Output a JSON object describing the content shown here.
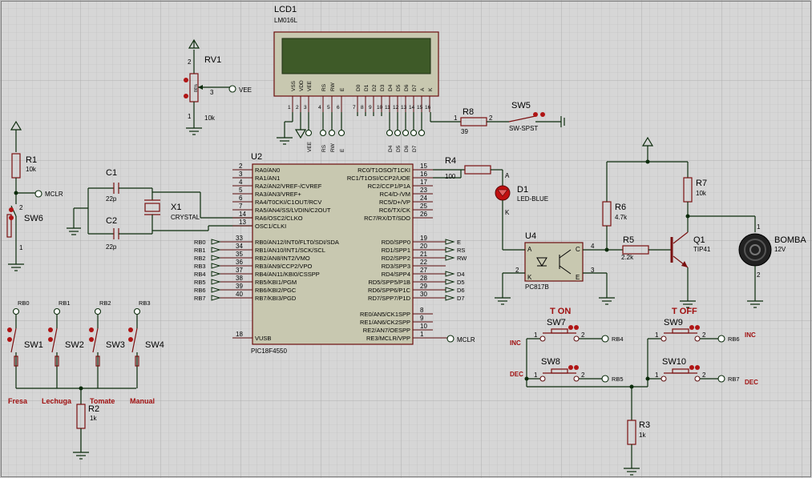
{
  "colors": {
    "grid_bg": "#d6d6d6",
    "grid_line": "#b9b9b9",
    "wire": "#0b2b0b",
    "component": "#7a1010",
    "chip_body": "#c8c8b0",
    "lcd_screen": "#3e5a28",
    "red_label": "#a01010"
  },
  "lcd": {
    "ref": "LCD1",
    "part": "LM016L",
    "pins": [
      "VSS",
      "VDD",
      "VEE",
      "RS",
      "RW",
      "E",
      "D0",
      "D1",
      "D2",
      "D3",
      "D4",
      "D5",
      "D6",
      "D7",
      "A",
      "K"
    ],
    "pin_numbers": [
      "1",
      "2",
      "3",
      "4",
      "5",
      "6",
      "7",
      "8",
      "9",
      "10",
      "11",
      "12",
      "13",
      "14",
      "15",
      "16"
    ],
    "net_left": [
      "VEE",
      "RS",
      "RW",
      "E"
    ],
    "net_data": [
      "D4",
      "D5",
      "D6",
      "D7"
    ]
  },
  "rv1": {
    "ref": "RV1",
    "value": "10k",
    "net": "VEE",
    "pin_top": "2",
    "pin_wiper": "3",
    "pin_bottom": "1",
    "body_text": "86%"
  },
  "r1": {
    "ref": "R1",
    "value": "10k",
    "net": "MCLR"
  },
  "sw6": {
    "ref": "SW6",
    "pin_top": "2",
    "pin_bottom": "1"
  },
  "c1": {
    "ref": "C1",
    "value": "22p"
  },
  "c2": {
    "ref": "C2",
    "value": "22p"
  },
  "x1": {
    "ref": "X1",
    "value": "CRYSTAL"
  },
  "u2": {
    "ref": "U2",
    "part": "PIC18F4550",
    "left_pins": [
      {
        "num": "2",
        "name": "RA0/AN0"
      },
      {
        "num": "3",
        "name": "RA1/AN1"
      },
      {
        "num": "4",
        "name": "RA2/AN2/VREF-/CVREF"
      },
      {
        "num": "5",
        "name": "RA3/AN3/VREF+"
      },
      {
        "num": "6",
        "name": "RA4/T0CKI/C1OUT/RCV"
      },
      {
        "num": "7",
        "name": "RA5/AN4/SS/LVDIN/C2OUT"
      },
      {
        "num": "14",
        "name": "RA6/OSC2/CLKO"
      },
      {
        "num": "13",
        "name": "OSC1/CLKI"
      }
    ],
    "left_pins_b": [
      {
        "num": "33",
        "name": "RB0/AN12/INT0/FLT0/SDI/SDA",
        "net": "RB0"
      },
      {
        "num": "34",
        "name": "RB1/AN10/INT1/SCK/SCL",
        "net": "RB1"
      },
      {
        "num": "35",
        "name": "RB2/AN8/INT2/VMO",
        "net": "RB2"
      },
      {
        "num": "36",
        "name": "RB3/AN9/CCP2/VPO",
        "net": "RB3"
      },
      {
        "num": "37",
        "name": "RB4/AN11/KBI0/CSSPP",
        "net": "RB4"
      },
      {
        "num": "38",
        "name": "RB5/KBI1/PGM",
        "net": "RB5"
      },
      {
        "num": "39",
        "name": "RB6/KBI2/PGC",
        "net": "RB6"
      },
      {
        "num": "40",
        "name": "RB7/KBI3/PGD",
        "net": "RB7"
      }
    ],
    "vusb": {
      "num": "18",
      "name": "VUSB"
    },
    "right_pins_c": [
      {
        "num": "15",
        "name": "RC0/T1OSO/T1CKI"
      },
      {
        "num": "16",
        "name": "RC1/T1OSI/CCP2/UOE"
      },
      {
        "num": "17",
        "name": "RC2/CCP1/P1A"
      },
      {
        "num": "23",
        "name": "RC4/D-/VM"
      },
      {
        "num": "24",
        "name": "RC5/D+/VP"
      },
      {
        "num": "25",
        "name": "RC6/TX/CK"
      },
      {
        "num": "26",
        "name": "RC7/RX/DT/SDO"
      }
    ],
    "right_pins_d": [
      {
        "num": "19",
        "name": "RD0/SPP0",
        "net": "E"
      },
      {
        "num": "20",
        "name": "RD1/SPP1",
        "net": "RS"
      },
      {
        "num": "21",
        "name": "RD2/SPP2",
        "net": "RW"
      },
      {
        "num": "22",
        "name": "RD3/SPP3",
        "net": ""
      },
      {
        "num": "27",
        "name": "RD4/SPP4",
        "net": "D4"
      },
      {
        "num": "28",
        "name": "RD5/SPP5/P1B",
        "net": "D5"
      },
      {
        "num": "29",
        "name": "RD6/SPP6/P1C",
        "net": "D6"
      },
      {
        "num": "30",
        "name": "RD7/SPP7/P1D",
        "net": "D7"
      }
    ],
    "right_pins_e": [
      {
        "num": "8",
        "name": "RE0/AN5/CK1SPP"
      },
      {
        "num": "9",
        "name": "RE1/AN6/CK2SPP"
      },
      {
        "num": "10",
        "name": "RE2/AN7/OESPP"
      },
      {
        "num": "1",
        "name": "RE3/MCLR/VPP",
        "net": "MCLR"
      }
    ]
  },
  "r8": {
    "ref": "R8",
    "value": "39",
    "pin_left": "1",
    "pin_right": "2"
  },
  "sw5": {
    "ref": "SW5",
    "value": "SW-SPST"
  },
  "r4": {
    "ref": "R4",
    "value": "100"
  },
  "d1": {
    "ref": "D1",
    "value": "LED-BLUE",
    "pin_a": "A",
    "pin_k": "K"
  },
  "u4": {
    "ref": "U4",
    "part": "PC817B",
    "pin_a": "A",
    "pin_k": "K",
    "pin_c": "C",
    "pin_e": "E",
    "p1": "1",
    "p2": "2",
    "p3": "3",
    "p4": "4"
  },
  "r5": {
    "ref": "R5",
    "value": "2.2k"
  },
  "r6": {
    "ref": "R6",
    "value": "4.7k"
  },
  "r7": {
    "ref": "R7",
    "value": "10k"
  },
  "q1": {
    "ref": "Q1",
    "value": "TIP41"
  },
  "motor": {
    "ref": "BOMBA",
    "value": "12V",
    "pin1": "1",
    "pin2": "2"
  },
  "switches": [
    {
      "ref": "SW1",
      "net": "RB0",
      "label": "Fresa"
    },
    {
      "ref": "SW2",
      "net": "RB1",
      "label": "Lechuga"
    },
    {
      "ref": "SW3",
      "net": "RB2",
      "label": "Tomate"
    },
    {
      "ref": "SW4",
      "net": "RB3",
      "label": "Manual"
    }
  ],
  "r2": {
    "ref": "R2",
    "value": "1k"
  },
  "r3": {
    "ref": "R3",
    "value": "1k"
  },
  "push": {
    "t_on": "T ON",
    "t_off": "T OFF",
    "inc": "INC",
    "dec": "DEC",
    "sw7": {
      "ref": "SW7",
      "net": "RB4"
    },
    "sw8": {
      "ref": "SW8",
      "net": "RB5"
    },
    "sw9": {
      "ref": "SW9",
      "net": "RB6"
    },
    "sw10": {
      "ref": "SW10",
      "net": "RB7"
    },
    "pin1": "1",
    "pin2": "2"
  },
  "mclr_net": "MCLR"
}
